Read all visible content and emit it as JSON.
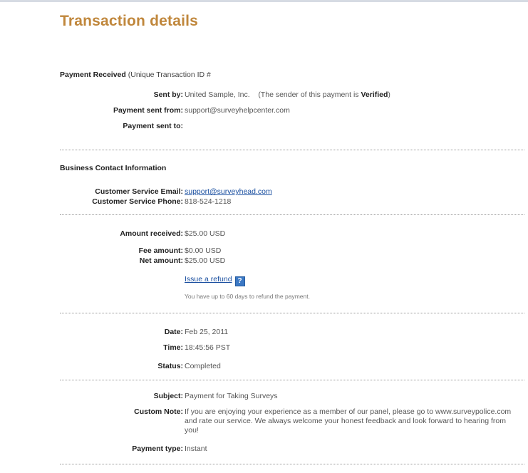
{
  "page": {
    "title": "Transaction details"
  },
  "payment_received": {
    "heading": "Payment Received",
    "heading_suffix": "(Unique Transaction ID #",
    "sent_by_label": "Sent by:",
    "sent_by_value": "United Sample, Inc.",
    "sender_note_prefix": "(The sender of this payment is",
    "sender_status": "Verified",
    "sender_note_suffix": ")",
    "sent_from_label": "Payment sent from:",
    "sent_from_value": "support@surveyhelpcenter.com",
    "sent_to_label": "Payment sent to:",
    "sent_to_value": ""
  },
  "business_contact": {
    "heading": "Business Contact Information",
    "email_label": "Customer Service Email:",
    "email_value": "support@surveyhead.com",
    "phone_label": "Customer Service Phone:",
    "phone_value": "818-524-1218"
  },
  "amounts": {
    "received_label": "Amount received:",
    "received_value": "$25.00 USD",
    "fee_label": "Fee amount:",
    "fee_value": "$0.00 USD",
    "net_label": "Net amount:",
    "net_value": "$25.00 USD",
    "refund_link": "Issue a refund",
    "refund_help_icon": "question-icon",
    "refund_note": "You have up to 60 days to refund the payment."
  },
  "status_info": {
    "date_label": "Date:",
    "date_value": "Feb 25, 2011",
    "time_label": "Time:",
    "time_value": "18:45:56 PST",
    "status_label": "Status:",
    "status_value": "Completed"
  },
  "details": {
    "subject_label": "Subject:",
    "subject_value": "Payment for Taking Surveys",
    "note_label": "Custom Note:",
    "note_value": "If you are enjoying your experience as a member of our panel, please go to www.surveypolice.com and rate our service. We always welcome your honest feedback and look forward to hearing from you!",
    "payment_type_label": "Payment type:",
    "payment_type_value": "Instant"
  },
  "colors": {
    "title": "#c0873c",
    "link": "#1a4fa0",
    "help_icon": "#3b78c4"
  }
}
